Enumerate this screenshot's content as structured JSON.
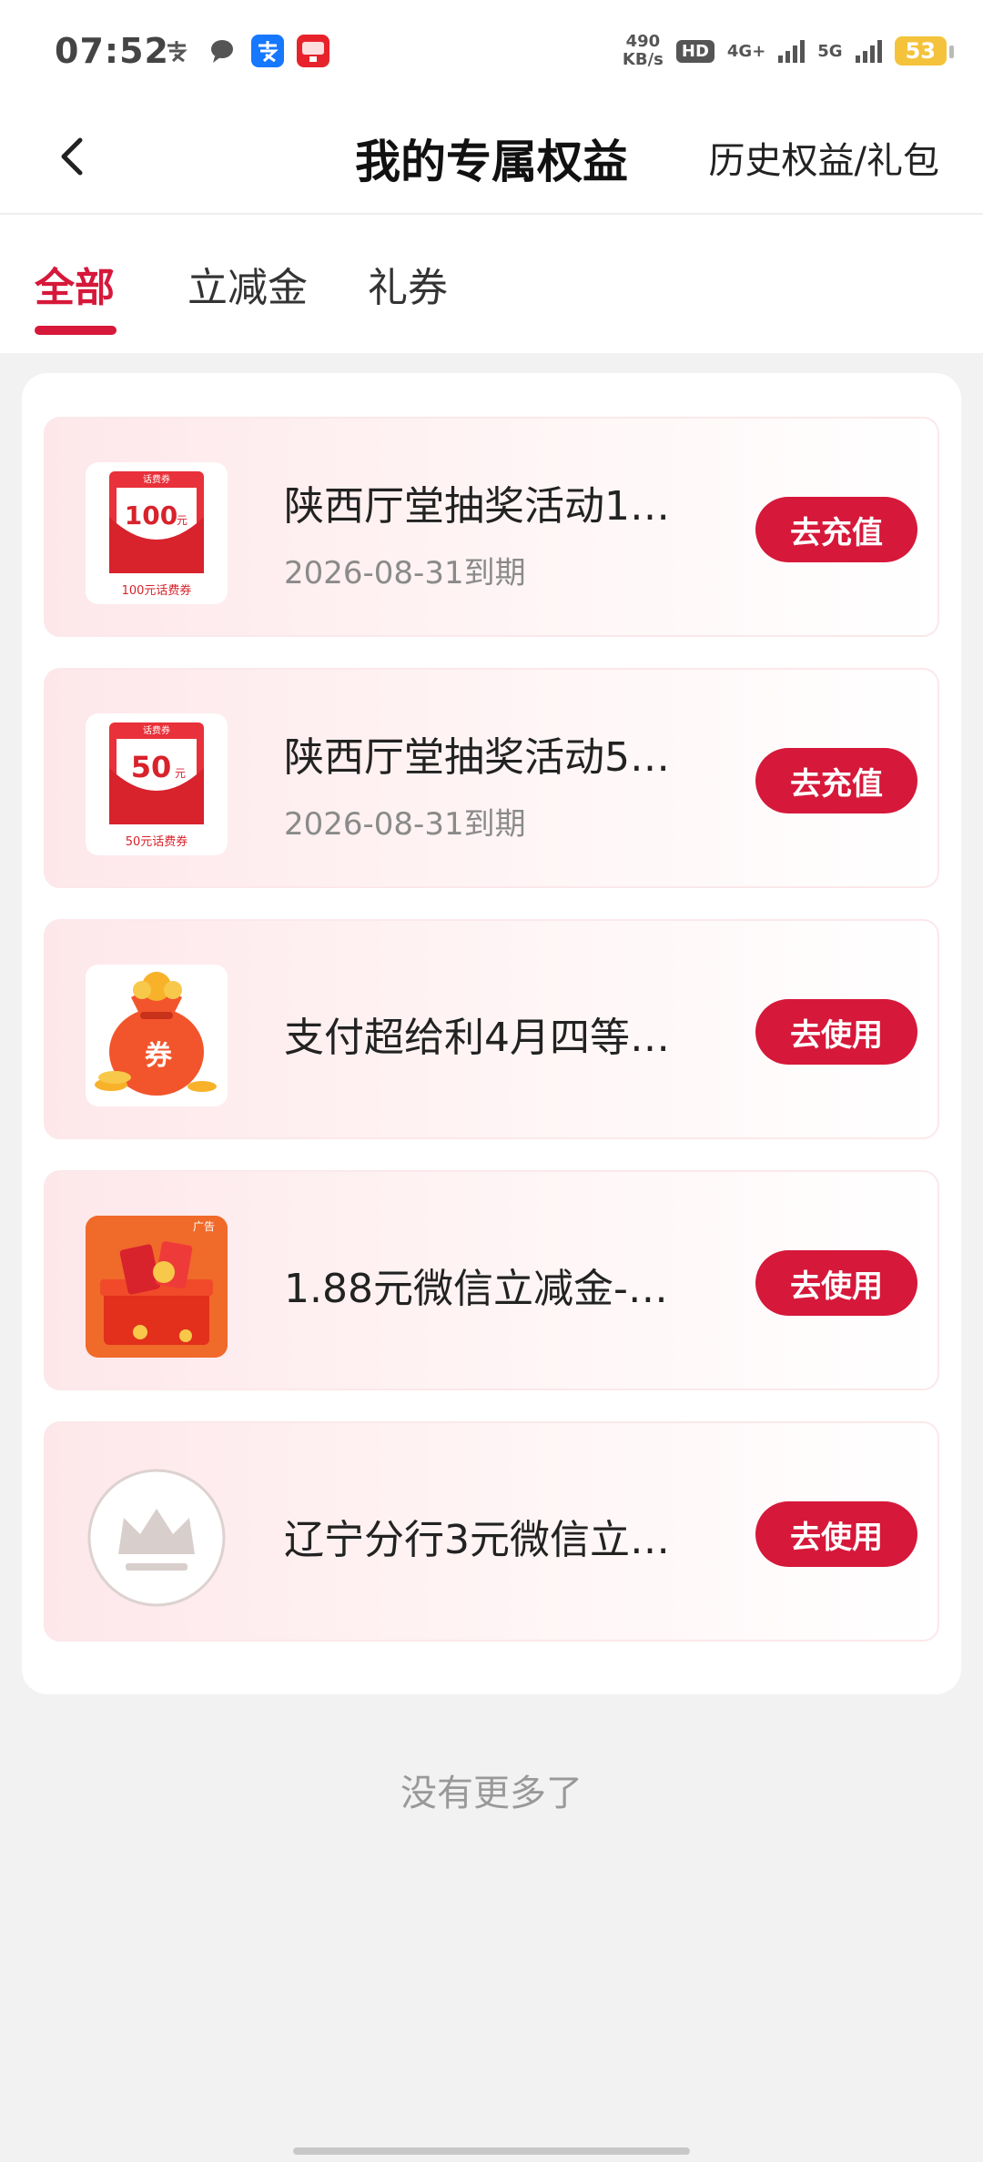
{
  "status_bar": {
    "time": "07:52",
    "speed_value": "490",
    "speed_unit": "KB/s",
    "hd": "HD",
    "network_1": "4G+",
    "network_2": "5G",
    "battery": "53"
  },
  "header": {
    "title": "我的专属权益",
    "history_link": "历史权益/礼包"
  },
  "tabs": [
    {
      "label": "全部"
    },
    {
      "label": "立减金"
    },
    {
      "label": "礼券"
    }
  ],
  "items": [
    {
      "title": "陕西厅堂抽奖活动1…",
      "expiry": "2026-08-31到期",
      "button": "去充值",
      "thumb": {
        "top_text": "话费券",
        "value": "100",
        "unit": "元",
        "caption": "100元话费券"
      }
    },
    {
      "title": "陕西厅堂抽奖活动5…",
      "expiry": "2026-08-31到期",
      "button": "去充值",
      "thumb": {
        "top_text": "话费券",
        "value": "50",
        "unit": "元",
        "caption": "50元话费券"
      }
    },
    {
      "title": "支付超给利4月四等…",
      "button": "去使用",
      "thumb": {
        "text": "券"
      }
    },
    {
      "title": "1.88元微信立减金-…",
      "button": "去使用",
      "thumb": {
        "badge": "广告"
      }
    },
    {
      "title": "辽宁分行3元微信立…",
      "button": "去使用"
    }
  ],
  "footer": {
    "no_more": "没有更多了"
  },
  "colors": {
    "accent": "#d6183a",
    "card_bg": "#ffffff",
    "page_bg": "#f2f2f2"
  }
}
